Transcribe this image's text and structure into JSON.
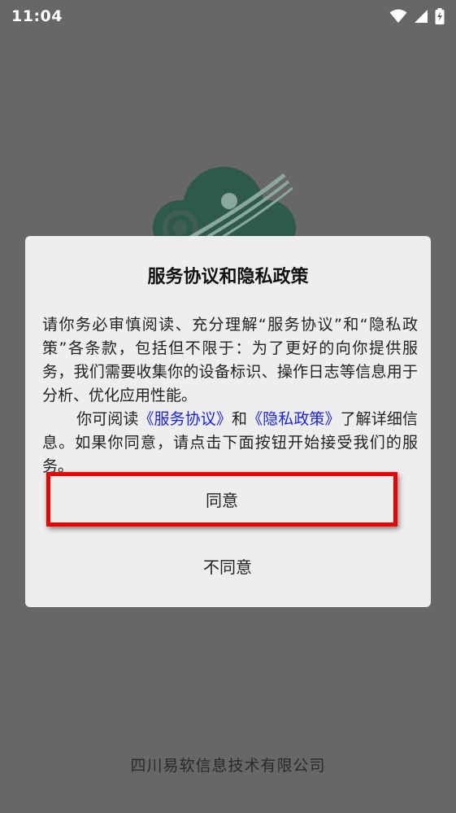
{
  "status_bar": {
    "time": "11:04",
    "icons": [
      "wifi-icon",
      "signal-icon",
      "battery-charging-icon"
    ]
  },
  "dialog": {
    "title": "服务协议和隐私政策",
    "paragraph1": "请你务必审慎阅读、充分理解“服务协议”和“隐私政策”各条款，包括但不限于：为了更好的向你提供服务，我们需要收集你的设备标识、操作日志等信息用于分析、优化应用性能。",
    "paragraph2_prefix": "你可阅读",
    "service_link": "《服务协议》",
    "paragraph2_and": "和",
    "privacy_link": "《隐私政策》",
    "paragraph2_suffix": "了解详细信息。如果你同意，请点击下面按钮开始接受我们的服务。",
    "agree_label": "同意",
    "disagree_label": "不同意"
  },
  "footer": {
    "company": "四川易软信息技术有限公司"
  },
  "colors": {
    "background": "#676767",
    "dialog": "#eeeeee",
    "link": "#1a22e8",
    "highlight": "#ee0000",
    "logo": "#2d5a4a"
  }
}
